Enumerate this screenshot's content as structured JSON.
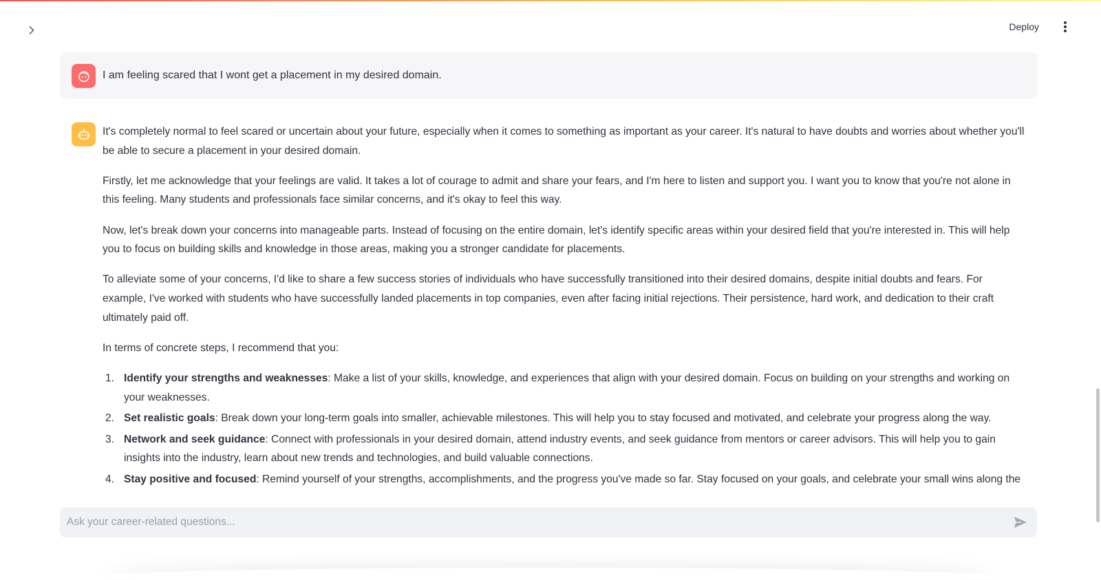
{
  "theme": {
    "accent_start": "#ff4b4b",
    "accent_end": "#fffd80",
    "user_avatar_color": "#ff6b6b",
    "bot_avatar_color": "#ffbd45"
  },
  "header": {
    "deploy_label": "Deploy",
    "menu_icon": "kebab-icon",
    "sidebar_icon": "chevron-right-icon"
  },
  "chat": {
    "user_message": "I am feeling scared that I wont get a placement in my desired domain.",
    "assistant": {
      "paragraphs": [
        "It's completely normal to feel scared or uncertain about your future, especially when it comes to something as important as your career. It's natural to have doubts and worries about whether you'll be able to secure a placement in your desired domain.",
        "Firstly, let me acknowledge that your feelings are valid. It takes a lot of courage to admit and share your fears, and I'm here to listen and support you. I want you to know that you're not alone in this feeling. Many students and professionals face similar concerns, and it's okay to feel this way.",
        "Now, let's break down your concerns into manageable parts. Instead of focusing on the entire domain, let's identify specific areas within your desired field that you're interested in. This will help you to focus on building skills and knowledge in those areas, making you a stronger candidate for placements.",
        "To alleviate some of your concerns, I'd like to share a few success stories of individuals who have successfully transitioned into their desired domains, despite initial doubts and fears. For example, I've worked with students who have successfully landed placements in top companies, even after facing initial rejections. Their persistence, hard work, and dedication to their craft ultimately paid off.",
        "In terms of concrete steps, I recommend that you:"
      ],
      "steps": [
        {
          "num": "1.",
          "title": "Identify your strengths and weaknesses",
          "text": ": Make a list of your skills, knowledge, and experiences that align with your desired domain. Focus on building on your strengths and working on your weaknesses."
        },
        {
          "num": "2.",
          "title": "Set realistic goals",
          "text": ": Break down your long-term goals into smaller, achievable milestones. This will help you to stay focused and motivated, and celebrate your progress along the way."
        },
        {
          "num": "3.",
          "title": "Network and seek guidance",
          "text": ": Connect with professionals in your desired domain, attend industry events, and seek guidance from mentors or career advisors. This will help you to gain insights into the industry, learn about new trends and technologies, and build valuable connections."
        },
        {
          "num": "4.",
          "title": "Stay positive and focused",
          "text": ": Remind yourself of your strengths, accomplishments, and the progress you've made so far. Stay focused on your goals, and celebrate your small wins along the way."
        }
      ]
    }
  },
  "input": {
    "placeholder": "Ask your career-related questions...",
    "value": "",
    "send_icon": "send-icon"
  }
}
